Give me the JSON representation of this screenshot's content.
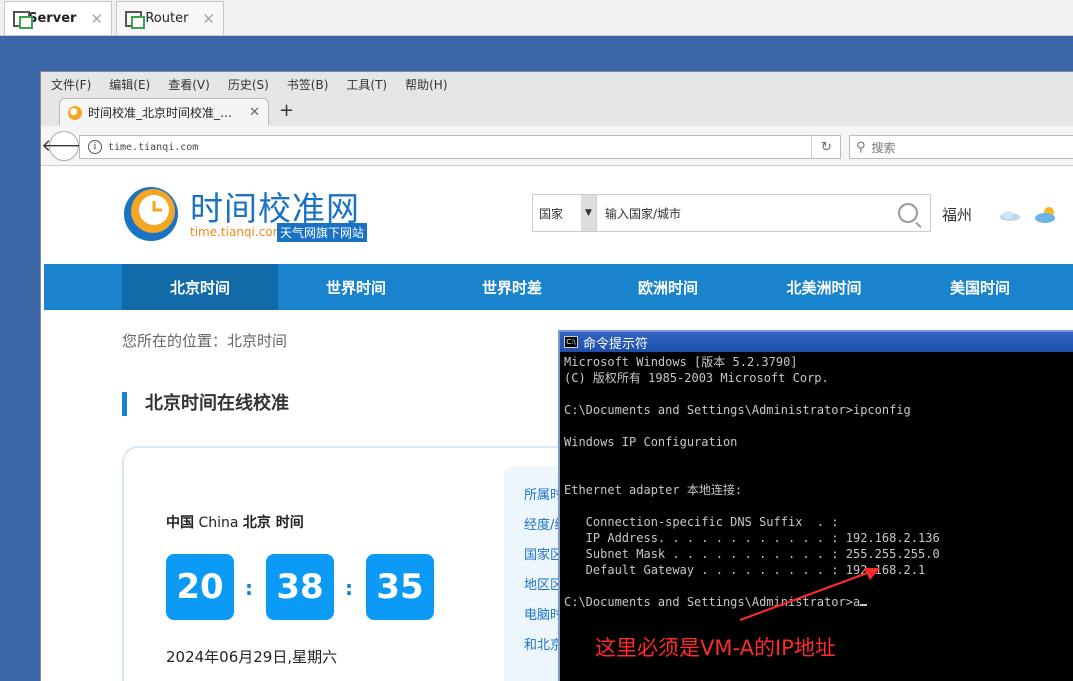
{
  "vm_tabs": [
    {
      "label": "Server",
      "active": true
    },
    {
      "label": "Router",
      "active": false
    }
  ],
  "browser": {
    "menu": [
      "文件(F)",
      "编辑(E)",
      "查看(V)",
      "历史(S)",
      "书签(B)",
      "工具(T)",
      "帮助(H)"
    ],
    "tab_title": "时间校准_北京时间校准_…",
    "url": "time.tianqi.com",
    "search_placeholder": "搜索"
  },
  "site": {
    "logo_title": "时间校准网",
    "logo_domain": "time.tianqi.com",
    "logo_badge": "天气网旗下网站",
    "country_select": "国家",
    "city_placeholder": "输入国家/城市",
    "city": "福州",
    "nav": [
      "北京时间",
      "世界时间",
      "世界时差",
      "欧洲时间",
      "北美洲时间",
      "美国时间"
    ],
    "breadcrumb": "您所在的位置：北京时间",
    "section_title": "北京时间在线校准",
    "clock": {
      "label_country": "中国",
      "label_en": "China",
      "label_city": "北京 时间",
      "hours": "20",
      "minutes": "38",
      "seconds": "35",
      "date": "2024年06月29日,星期六"
    },
    "side_links": [
      "所属时",
      "经度/纬",
      "国家区",
      "地区区",
      "电脑时",
      "和北京"
    ]
  },
  "cmd": {
    "title": "命令提示符",
    "icon": "C:\\",
    "lines": [
      "Microsoft Windows [版本 5.2.3790]",
      "(C) 版权所有 1985-2003 Microsoft Corp.",
      "",
      "C:\\Documents and Settings\\Administrator>ipconfig",
      "",
      "Windows IP Configuration",
      "",
      "",
      "Ethernet adapter 本地连接:",
      "",
      "   Connection-specific DNS Suffix  . :",
      "   IP Address. . . . . . . . . . . . : 192.168.2.136",
      "   Subnet Mask . . . . . . . . . . . : 255.255.255.0",
      "   Default Gateway . . . . . . . . . : 192.168.2.1",
      "",
      "C:\\Documents and Settings\\Administrator>a"
    ]
  },
  "annotation": "这里必须是VM-A的IP地址",
  "colors": {
    "accent": "#1a83cd",
    "annotation": "#ff2a2a"
  }
}
